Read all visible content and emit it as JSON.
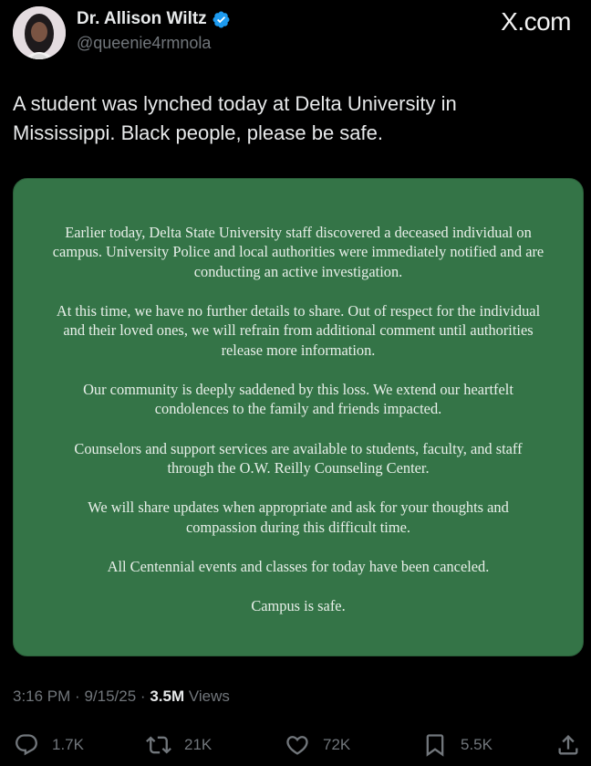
{
  "header": {
    "display_name": "Dr. Allison Wiltz",
    "handle": "@queenie4rmnola",
    "brand": "X.com"
  },
  "tweet": {
    "text_line1": "A student was lynched today at Delta University in",
    "text_line2": "Mississippi. Black people, please be safe."
  },
  "media": {
    "paragraphs": [
      [
        "Earlier today, Delta State University staff discovered a deceased individual on",
        "campus. University Police and local authorities were immediately notified and are",
        "conducting an active investigation."
      ],
      [
        "At this time, we have no further details to share. Out of respect for the individual",
        "and their loved ones, we will refrain from additional comment until authorities",
        "release more information."
      ],
      [
        "Our community is deeply saddened by this loss. We extend our heartfelt",
        "condolences to the family and friends impacted."
      ],
      [
        "Counselors and support services are available to students, faculty, and staff",
        "through the O.W. Reilly Counseling Center."
      ],
      [
        "We will share updates when appropriate and ask for your thoughts and",
        "compassion during this difficult time."
      ],
      [
        "All Centennial events and classes for today have been canceled."
      ],
      [
        "Campus is safe."
      ]
    ]
  },
  "meta": {
    "time": "3:16 PM",
    "date": "9/15/25",
    "separator": "·",
    "views_count": "3.5M",
    "views_label": "Views"
  },
  "actions": {
    "replies": "1.7K",
    "reposts": "21K",
    "likes": "72K",
    "bookmarks": "5.5K"
  },
  "colors": {
    "background": "#000000",
    "card_green": "#347447",
    "verified_blue": "#1d9bf0",
    "muted": "#71767b"
  },
  "icons": [
    "verified-badge-icon",
    "reply-icon",
    "repost-icon",
    "like-icon",
    "bookmark-icon",
    "share-icon"
  ]
}
